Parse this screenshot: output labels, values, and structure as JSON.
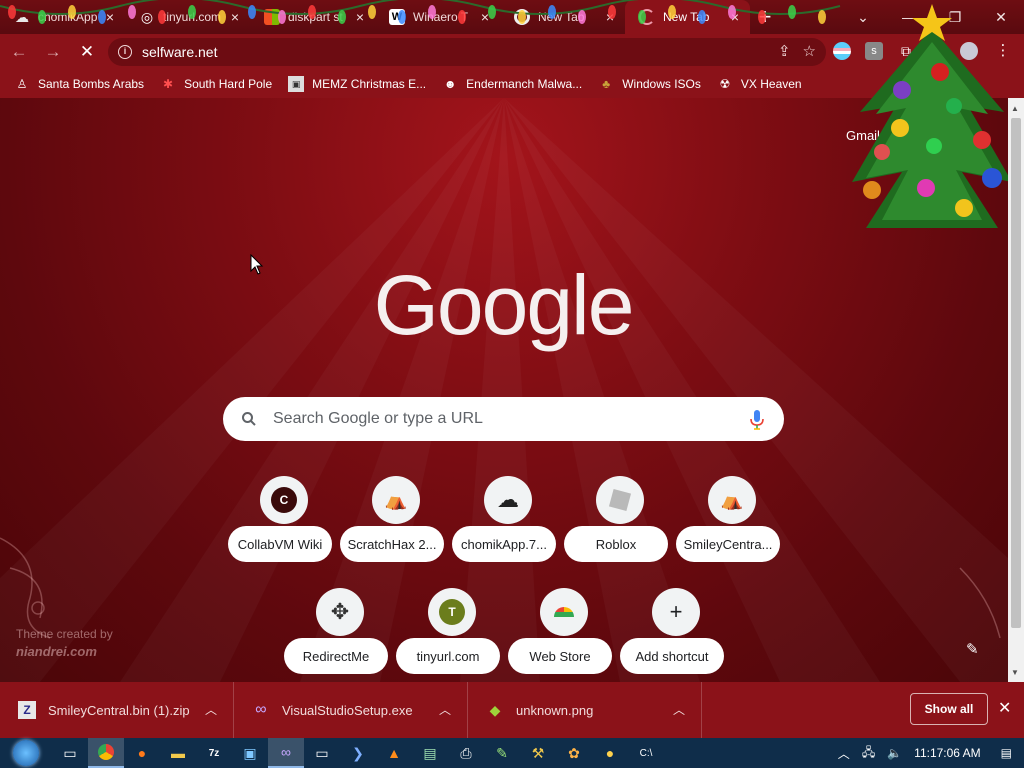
{
  "tabs": [
    {
      "title": "chomikApp",
      "icon": "chomik-icon",
      "active": false
    },
    {
      "title": "tinyurl.com",
      "icon": "globe-icon",
      "active": false
    },
    {
      "title": "diskpart st",
      "icon": "windows-icon",
      "active": false
    },
    {
      "title": "Winaero T",
      "icon": "winaero-w-icon",
      "active": false
    },
    {
      "title": "New Tab",
      "icon": "chrome-icon",
      "active": false
    },
    {
      "title": "New Tab",
      "icon": "loading-spinner-icon",
      "active": true
    }
  ],
  "window": {
    "new_tab": "+",
    "tab_search": "⌄",
    "minimize": "—",
    "maximize": "❐",
    "close": "✕"
  },
  "toolbar": {
    "back": "←",
    "forward": "→",
    "reload": "✕",
    "url": "selfware.net",
    "share": "⇪",
    "bookmark_star": "☆",
    "extensions": "⧉",
    "menu": "⋮"
  },
  "bookmarks": [
    {
      "label": "Santa Bombs Arabs",
      "icon": "santa-icon"
    },
    {
      "label": "South Hard Pole",
      "icon": "star-icon"
    },
    {
      "label": "MEMZ Christmas E...",
      "icon": "memz-icon"
    },
    {
      "label": "Endermanch Malwa...",
      "icon": "ender-icon"
    },
    {
      "label": "Windows ISOs",
      "icon": "folder-icon"
    },
    {
      "label": "VX Heaven",
      "icon": "vx-icon"
    }
  ],
  "ntp": {
    "gmail": "Gmail",
    "logo": "Google",
    "search_placeholder": "Search Google or type a URL",
    "shortcuts": [
      {
        "label": "CollabVM Wiki",
        "icon": "letter-c-icon",
        "letter": "C"
      },
      {
        "label": "ScratchHax 2...",
        "icon": "scratchhax-icon"
      },
      {
        "label": "chomikApp.7...",
        "icon": "cloud-upload-icon"
      },
      {
        "label": "Roblox",
        "icon": "roblox-icon"
      },
      {
        "label": "SmileyCentra...",
        "icon": "smiley-icon"
      },
      {
        "label": "RedirectMe",
        "icon": "move-arrows-icon"
      },
      {
        "label": "tinyurl.com",
        "icon": "letter-t-icon",
        "letter": "T"
      },
      {
        "label": "Web Store",
        "icon": "webstore-icon"
      },
      {
        "label": "Add shortcut",
        "icon": "plus-icon"
      }
    ],
    "theme_credit": "Theme created by",
    "theme_author": "niandrei.com"
  },
  "downloads": [
    {
      "name": "SmileyCentral.bin (1).zip",
      "icon": "zip-icon"
    },
    {
      "name": "VisualStudioSetup.exe",
      "icon": "visual-studio-icon"
    },
    {
      "name": "unknown.png",
      "icon": "image-icon"
    }
  ],
  "download_shelf": {
    "show_all": "Show all",
    "close": "✕"
  },
  "taskbar": {
    "apps": [
      "start",
      "task-view",
      "chrome",
      "firefox",
      "explorer",
      "7zip",
      "control-panel",
      "visual-studio",
      "window",
      "powershell",
      "vlc",
      "remote",
      "notepadpp",
      "tools",
      "paint",
      "misc",
      "cmd"
    ],
    "clock": "11:17:06 AM"
  },
  "colors": {
    "theme": "#8b1219",
    "frame": "#6e0d12",
    "taskbar": "#0f2d4a"
  }
}
